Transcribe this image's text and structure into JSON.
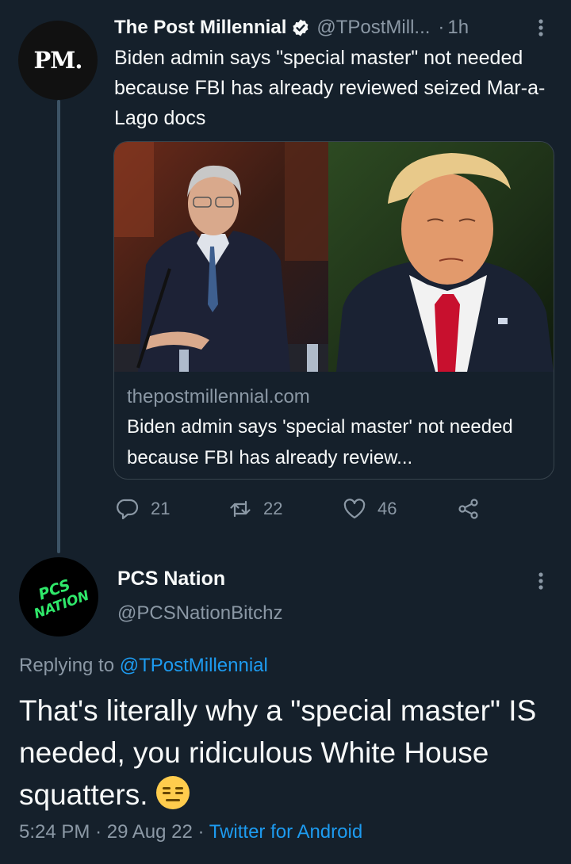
{
  "tweet1": {
    "avatar_text": "PM.",
    "name": "The Post Millennial",
    "handle": "@TPostMill...",
    "separator": "·",
    "time": "1h",
    "text": "Biden admin says \"special master\" not needed because FBI has already reviewed seized Mar-a-Lago docs",
    "card": {
      "domain": "thepostmillennial.com",
      "title": "Biden admin says 'special master' not needed because FBI has already review..."
    },
    "actions": {
      "replies": "21",
      "retweets": "22",
      "likes": "46"
    }
  },
  "tweet2": {
    "avatar_text": "PCS NATION",
    "name": "PCS Nation",
    "handle": "@PCSNationBitchz",
    "replying_prefix": "Replying to",
    "replying_to": "@TPostMillennial",
    "text": "That's literally why a \"special master\" IS needed, you ridiculous White House squatters.",
    "emoji": "expressionless-face",
    "time": "5:24 PM",
    "date": "29 Aug 22",
    "separator": "·",
    "source": "Twitter for Android"
  },
  "colors": {
    "background": "#15202b",
    "text": "#f7f9f9",
    "secondary": "#8b98a5",
    "link": "#1d9bf0",
    "pcs_green": "#2fe86a"
  }
}
